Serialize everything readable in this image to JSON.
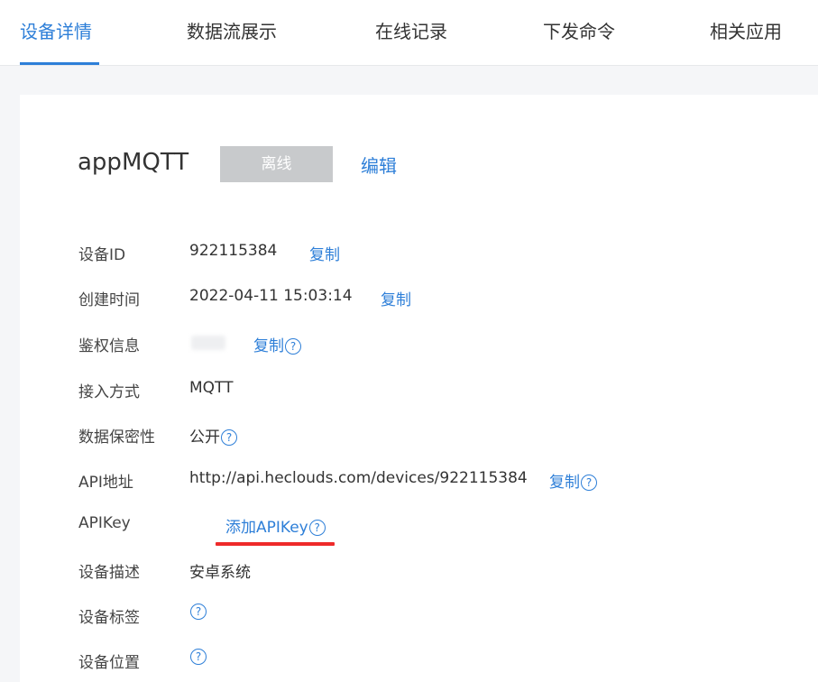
{
  "tabs": [
    "设备详情",
    "数据流展示",
    "在线记录",
    "下发命令",
    "相关应用"
  ],
  "device": {
    "name": "appMQTT",
    "status": "离线",
    "edit_label": "编辑"
  },
  "rows": {
    "device_id": {
      "label": "设备ID",
      "value": "922115384",
      "action": "复制"
    },
    "created": {
      "label": "创建时间",
      "value": "2022-04-11 15:03:14",
      "action": "复制"
    },
    "auth": {
      "label": "鉴权信息",
      "action": "复制"
    },
    "access": {
      "label": "接入方式",
      "value": "MQTT"
    },
    "privacy": {
      "label": "数据保密性",
      "value": "公开"
    },
    "api_url": {
      "label": "API地址",
      "value": "http://api.heclouds.com/devices/922115384",
      "action": "复制"
    },
    "apikey": {
      "label": "APIKey",
      "action": "添加APIKey"
    },
    "desc": {
      "label": "设备描述",
      "value": "安卓系统"
    },
    "tags": {
      "label": "设备标签"
    },
    "location": {
      "label": "设备位置"
    }
  },
  "help_glyph": "?",
  "colors": {
    "accent": "#2e7fd8",
    "status_bg": "#c8cacc",
    "highlight": "#ee2a2a"
  }
}
